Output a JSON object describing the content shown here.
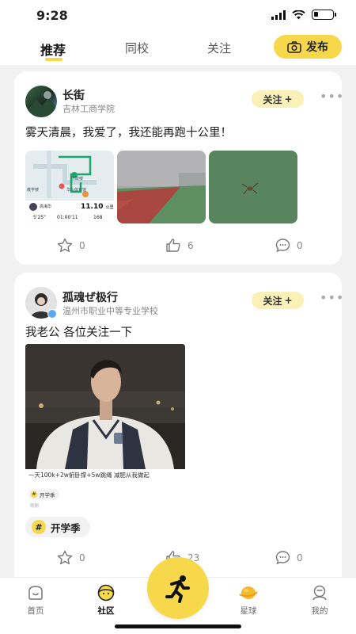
{
  "status_bar": {
    "time": "9:28"
  },
  "top_nav": {
    "tabs": [
      {
        "label": "推荐",
        "active": true
      },
      {
        "label": "同校",
        "active": false
      },
      {
        "label": "关注",
        "active": false
      }
    ],
    "publish_label": "发布"
  },
  "posts": [
    {
      "username": "长街",
      "school": "吉林工商学院",
      "follow_label": "关注",
      "text": "雾天清晨，我爱了，我还能再跑十公里！",
      "map_card": {
        "place1": "行政楼",
        "place2": "华山体育馆",
        "place3": "教学楼",
        "runner": "高海华",
        "distance": "11.10",
        "distance_unit": "公里",
        "pace": "5'25\"",
        "duration": "01:00'11",
        "cadence": "168"
      },
      "stats": {
        "favorites": "0",
        "likes": "6",
        "comments": "0"
      }
    },
    {
      "username": "孤魂ぜ极行",
      "school": "温州市职业中等专业学校",
      "follow_label": "关注",
      "text": "我老公 各位关注一下",
      "embedded_caption": "一天100k+2w俯卧撑+5w跳绳 减肥从我做起",
      "embedded_tag": "开学季",
      "embedded_sub": "刚刚",
      "topic_tag": "开学季",
      "stats": {
        "favorites": "0",
        "likes": "23",
        "comments": "0"
      }
    }
  ],
  "bottom_nav": {
    "items": [
      {
        "label": "首页",
        "icon": "home-icon"
      },
      {
        "label": "社区",
        "icon": "community-icon"
      },
      {
        "label": "星球",
        "icon": "planet-icon"
      },
      {
        "label": "我的",
        "icon": "profile-icon"
      }
    ],
    "center_icon": "run-icon"
  },
  "colors": {
    "accent": "#f7d84a",
    "follow_bg": "#fbf0b8",
    "background": "#f2f2f2"
  }
}
